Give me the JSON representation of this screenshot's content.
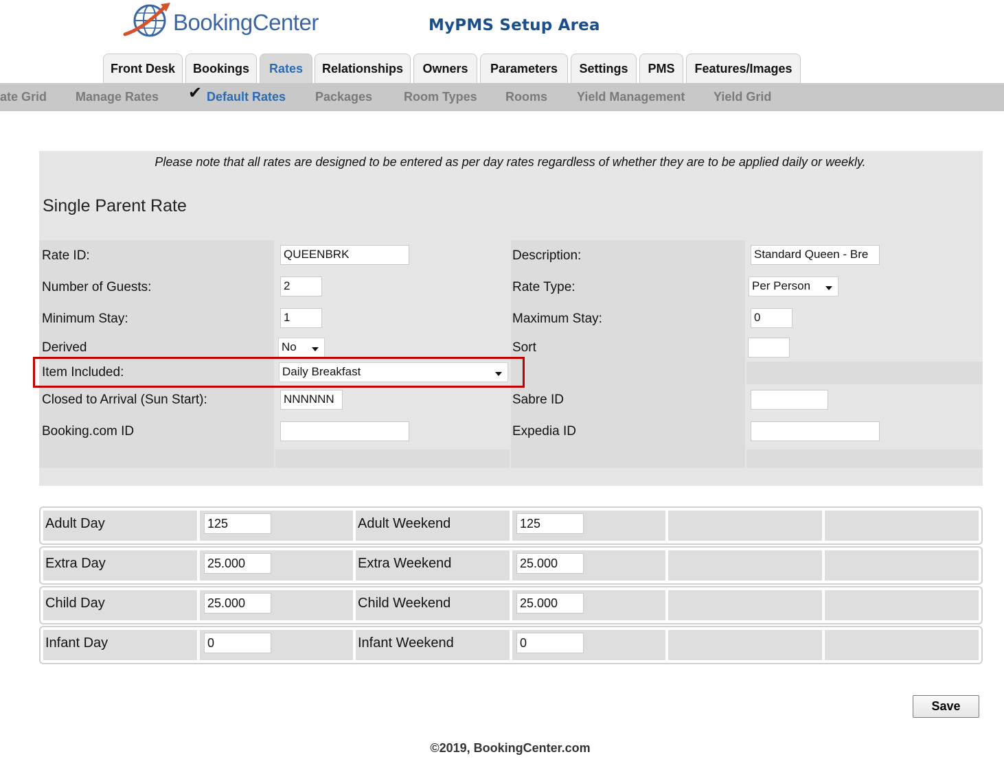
{
  "brand": {
    "name": "BookingCenter",
    "title": "MyPMS Setup Area",
    "accent": "#2c6bb3"
  },
  "tabs": [
    {
      "label": "Front Desk"
    },
    {
      "label": "Bookings"
    },
    {
      "label": "Rates",
      "active": true
    },
    {
      "label": "Relationships"
    },
    {
      "label": "Owners"
    },
    {
      "label": "Parameters"
    },
    {
      "label": "Settings"
    },
    {
      "label": "PMS"
    },
    {
      "label": "Features/Images"
    }
  ],
  "subnav": [
    {
      "label": "ate Grid"
    },
    {
      "label": "Manage Rates"
    },
    {
      "label": "Default Rates",
      "active": true
    },
    {
      "label": "Packages"
    },
    {
      "label": "Room Types"
    },
    {
      "label": "Rooms"
    },
    {
      "label": "Yield Management"
    },
    {
      "label": "Yield Grid"
    }
  ],
  "note": "Please note that all rates are designed to be entered as per day rates regardless of whether they are to be applied daily or weekly.",
  "rate_name": "Single Parent Rate",
  "form": {
    "rate_id": {
      "label": "Rate ID:",
      "value": "QUEENBRK"
    },
    "description": {
      "label": "Description:",
      "value": "Standard Queen - Bre"
    },
    "num_guests": {
      "label": "Number of Guests:",
      "value": "2"
    },
    "rate_type": {
      "label": "Rate Type:",
      "value": "Per Person"
    },
    "min_stay": {
      "label": "Minimum Stay:",
      "value": "1"
    },
    "max_stay": {
      "label": "Maximum Stay:",
      "value": "0"
    },
    "derived": {
      "label": "Derived",
      "value": "No"
    },
    "sort": {
      "label": "Sort",
      "value": ""
    },
    "item_included": {
      "label": "Item Included:",
      "value": "Daily Breakfast"
    },
    "closed_to_arrival": {
      "label": "Closed to Arrival (Sun Start):",
      "value": "NNNNNN"
    },
    "sabre_id": {
      "label": "Sabre ID",
      "value": ""
    },
    "booking_id": {
      "label": "Booking.com ID",
      "value": ""
    },
    "expedia_id": {
      "label": "Expedia ID",
      "value": ""
    }
  },
  "rates": [
    {
      "day_label": "Adult Day",
      "day_value": "125",
      "weekend_label": "Adult Weekend",
      "weekend_value": "125"
    },
    {
      "day_label": "Extra Day",
      "day_value": "25.000",
      "weekend_label": "Extra Weekend",
      "weekend_value": "25.000"
    },
    {
      "day_label": "Child Day",
      "day_value": "25.000",
      "weekend_label": "Child Weekend",
      "weekend_value": "25.000"
    },
    {
      "day_label": "Infant Day",
      "day_value": "0",
      "weekend_label": "Infant Weekend",
      "weekend_value": "0"
    }
  ],
  "save_label": "Save",
  "footer": "©2019, BookingCenter.com",
  "highlight_color": "#c00000"
}
